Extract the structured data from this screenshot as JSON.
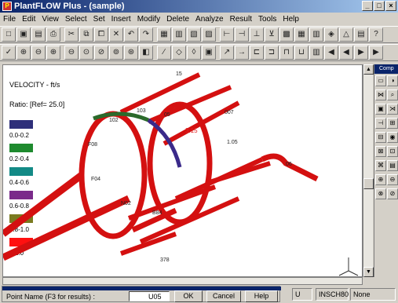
{
  "window": {
    "title": "PlantFLOW Plus - (sample)",
    "controls": [
      "_",
      "□",
      "×"
    ]
  },
  "menu": [
    "File",
    "Edit",
    "View",
    "Select",
    "Set",
    "Insert",
    "Modify",
    "Delete",
    "Analyze",
    "Result",
    "Tools",
    "Help"
  ],
  "toolbar1": [
    "□",
    "▣",
    "▤",
    "⎙",
    "✂",
    "⧉",
    "⧠",
    "✕",
    "↶",
    "↷",
    "▦",
    "▥",
    "▧",
    "▨",
    "⊢",
    "⊣",
    "⊥",
    "⊻",
    "▩",
    "▦",
    "▥",
    "◈",
    "△",
    "▤",
    "?"
  ],
  "toolbar2": [
    "✓",
    "⊕",
    "⊖",
    "⊕",
    "⊖",
    "⊙",
    "⊘",
    "⊚",
    "⊛",
    "◧",
    "∕",
    "◇",
    "◊",
    "▣",
    "↗",
    "→",
    "⊏",
    "⊐",
    "⊓",
    "⊔",
    "▥",
    "◀",
    "◀",
    "▶",
    "▶"
  ],
  "legend": {
    "title": "VELOCITY -    ft/s",
    "ratio": "Ratio: [Ref=  25.0]",
    "bands": [
      {
        "label": "0.0-0.2",
        "color": "#2e2f7a"
      },
      {
        "label": "0.2-0.4",
        "color": "#1e8a2e"
      },
      {
        "label": "0.4-0.6",
        "color": "#138a86"
      },
      {
        "label": "0.6-0.8",
        "color": "#7a2a8a"
      },
      {
        "label": "0.8-1.0",
        "color": "#7a7a20"
      },
      {
        "label": "> 1.0",
        "color": "#ff1010"
      }
    ]
  },
  "model_labels": [
    "15",
    "3.15",
    "102",
    "103",
    "05",
    "F08",
    "F04",
    "N02",
    "B84",
    "378",
    "06",
    "007",
    "1.05"
  ],
  "palette": {
    "title": "Comp"
  },
  "pointname": {
    "label": "Point Name (F3 for results) :",
    "value": "U05",
    "ok": "OK",
    "cancel": "Cancel",
    "help": "Help"
  },
  "status": {
    "field1": "U",
    "field2": "INSCH80",
    "field3": "None"
  }
}
